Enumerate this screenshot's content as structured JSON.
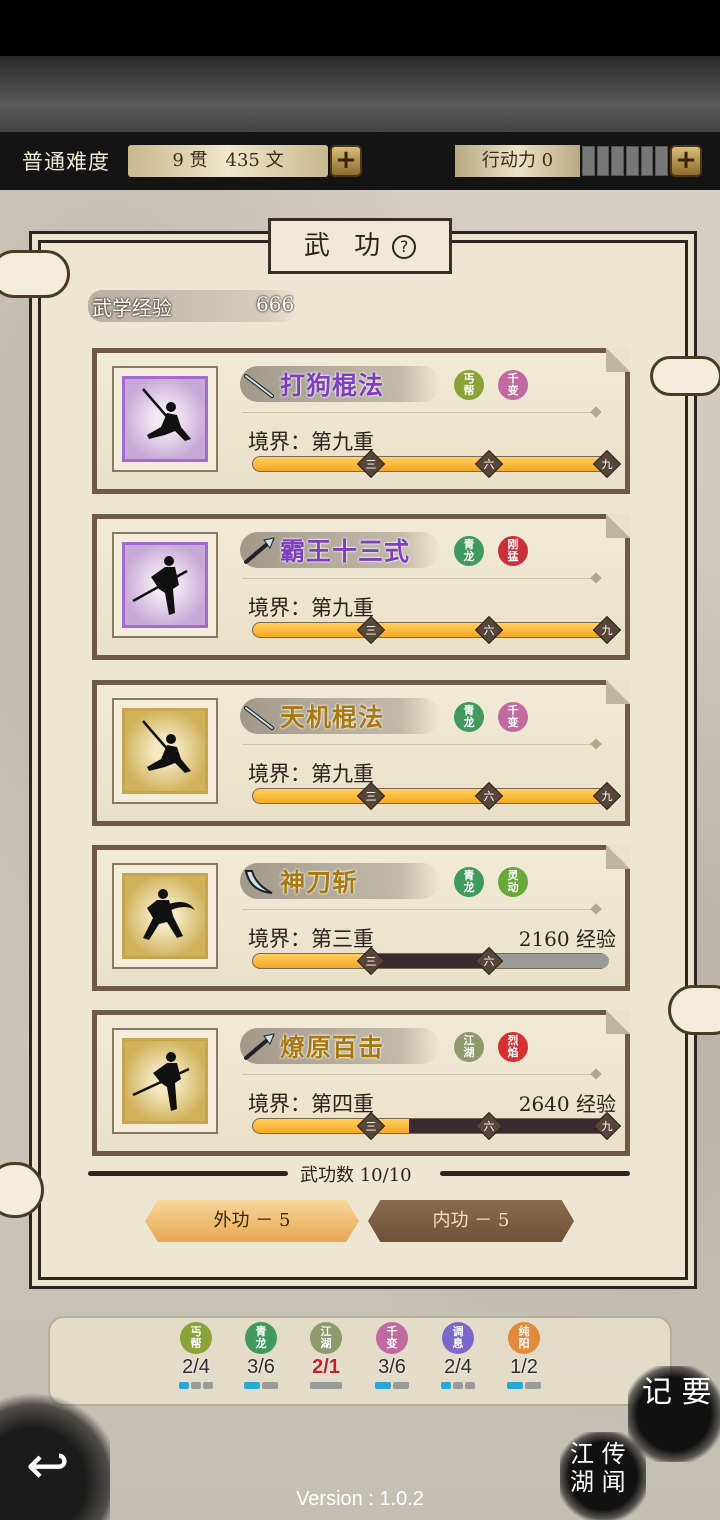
{
  "header": {
    "difficulty": "普通难度",
    "money": "9 贯　435 文",
    "energy": "行动力 0",
    "add_label": "+"
  },
  "panel": {
    "title": "武 功",
    "help": "?",
    "exp_label": "武学经验",
    "exp_value": "666",
    "count_label": "武功数 10/10"
  },
  "skills": [
    {
      "name": "打狗棍法",
      "realm": "境界：第九重",
      "exp": "",
      "progress": 1.0,
      "tags": [
        [
          "丐",
          "帮"
        ],
        [
          "千",
          "变"
        ]
      ]
    },
    {
      "name": "霸王十三式",
      "realm": "境界：第九重",
      "exp": "",
      "progress": 1.0,
      "tags": [
        [
          "青",
          "龙"
        ],
        [
          "刚",
          "猛"
        ]
      ]
    },
    {
      "name": "天机棍法",
      "realm": "境界：第九重",
      "exp": "",
      "progress": 1.0,
      "tags": [
        [
          "青",
          "龙"
        ],
        [
          "千",
          "变"
        ]
      ]
    },
    {
      "name": "神刀斩",
      "realm": "境界：第三重",
      "exp": "2160 经验",
      "progress": 0.33,
      "tags": [
        [
          "青",
          "龙"
        ],
        [
          "灵",
          "动"
        ]
      ]
    },
    {
      "name": "燎原百击",
      "realm": "境界：第四重",
      "exp": "2640 经验",
      "progress": 0.44,
      "tags": [
        [
          "江",
          "湖"
        ],
        [
          "烈",
          "焰"
        ]
      ]
    }
  ],
  "bar_markers": [
    "三",
    "六",
    "九"
  ],
  "buttons": {
    "external": "外功 － 5",
    "internal": "内功 － 5"
  },
  "factions": [
    {
      "name": [
        "丐",
        "帮"
      ],
      "count": "2/4",
      "color": "#8aa236"
    },
    {
      "name": [
        "青",
        "龙"
      ],
      "count": "3/6",
      "color": "#3f9a5c"
    },
    {
      "name": [
        "江",
        "湖"
      ],
      "count": "2/1",
      "color": "#8f9a6c"
    },
    {
      "name": [
        "千",
        "变"
      ],
      "count": "3/6",
      "color": "#c06aa0"
    },
    {
      "name": [
        "调",
        "息"
      ],
      "count": "2/4",
      "color": "#7a68c9"
    },
    {
      "name": [
        "纯",
        "阳"
      ],
      "count": "1/2",
      "color": "#e08a3a"
    }
  ],
  "bottom": {
    "back_icon": "back-arrow-icon",
    "notes": "记 要",
    "lore": "江 传\n湖 闻",
    "version": "Version : 1.0.2"
  },
  "colors": {
    "purple_accent": "#7d3fbf",
    "gold_accent": "#a77910",
    "progress": "#f5a623"
  }
}
